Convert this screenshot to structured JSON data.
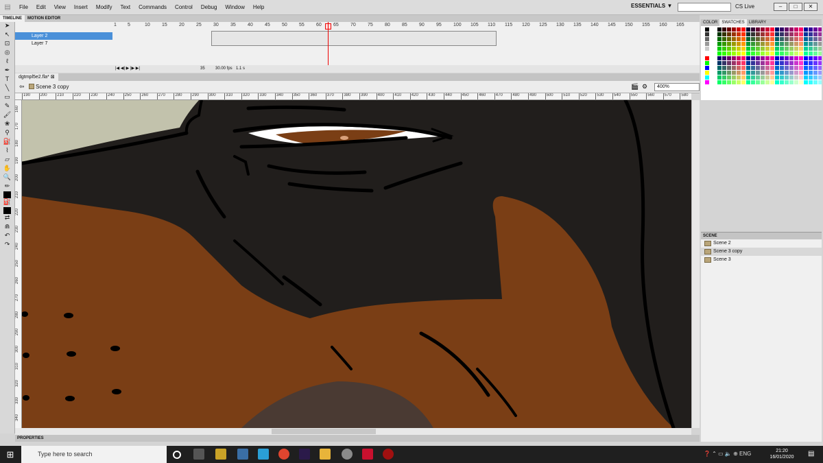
{
  "menu": [
    "File",
    "Edit",
    "View",
    "Insert",
    "Modify",
    "Text",
    "Commands",
    "Control",
    "Debug",
    "Window",
    "Help"
  ],
  "workspace": "ESSENTIALS ▼",
  "cslive": "CS Live",
  "timeline_tabs": [
    "TIMELINE",
    "MOTION EDITOR"
  ],
  "layers": [
    "Layer 2",
    "Layer 7"
  ],
  "frame_numbers": [
    "1",
    "5",
    "10",
    "15",
    "20",
    "25",
    "30",
    "35",
    "40",
    "45",
    "50",
    "55",
    "60",
    "65",
    "70",
    "75",
    "80",
    "85",
    "90",
    "95",
    "100",
    "105",
    "110",
    "115",
    "120",
    "125",
    "130",
    "135",
    "140",
    "145",
    "150",
    "155",
    "160",
    "165"
  ],
  "current_frame": "35",
  "fps": "30.00 fps",
  "time": "1.1 s",
  "doc_tab": "dgtmpl5e2.fla*",
  "scene_name": "Scene 3 copy",
  "zoom": "400%",
  "h_ruler": [
    "190",
    "200",
    "210",
    "220",
    "230",
    "240",
    "250",
    "260",
    "270",
    "280",
    "290",
    "300",
    "310",
    "320",
    "330",
    "340",
    "350",
    "360",
    "370",
    "380",
    "390",
    "400",
    "410",
    "420",
    "430",
    "440",
    "450",
    "460",
    "470",
    "480",
    "490",
    "500",
    "510",
    "520",
    "530",
    "540",
    "550",
    "560",
    "570",
    "580"
  ],
  "v_ruler": [
    "160",
    "170",
    "180",
    "190",
    "200",
    "210",
    "220",
    "230",
    "240",
    "250",
    "260",
    "270",
    "280",
    "290",
    "300",
    "310",
    "320",
    "330",
    "340"
  ],
  "properties_label": "PROPERTIES",
  "right_tabs": [
    "COLOR",
    "SWATCHES",
    "LIBRARY"
  ],
  "scene_panel": {
    "title": "SCENE",
    "items": [
      "Scene 2",
      "Scene 3 copy",
      "Scene 3"
    ]
  },
  "taskbar": {
    "search_placeholder": "Type here to search",
    "time": "21:20",
    "date": "16/01/2020"
  },
  "colors": {
    "skin": "#7a3e15",
    "hair": "#211e1c",
    "bg": "#c2c2ac",
    "playhead": "#e00000"
  }
}
